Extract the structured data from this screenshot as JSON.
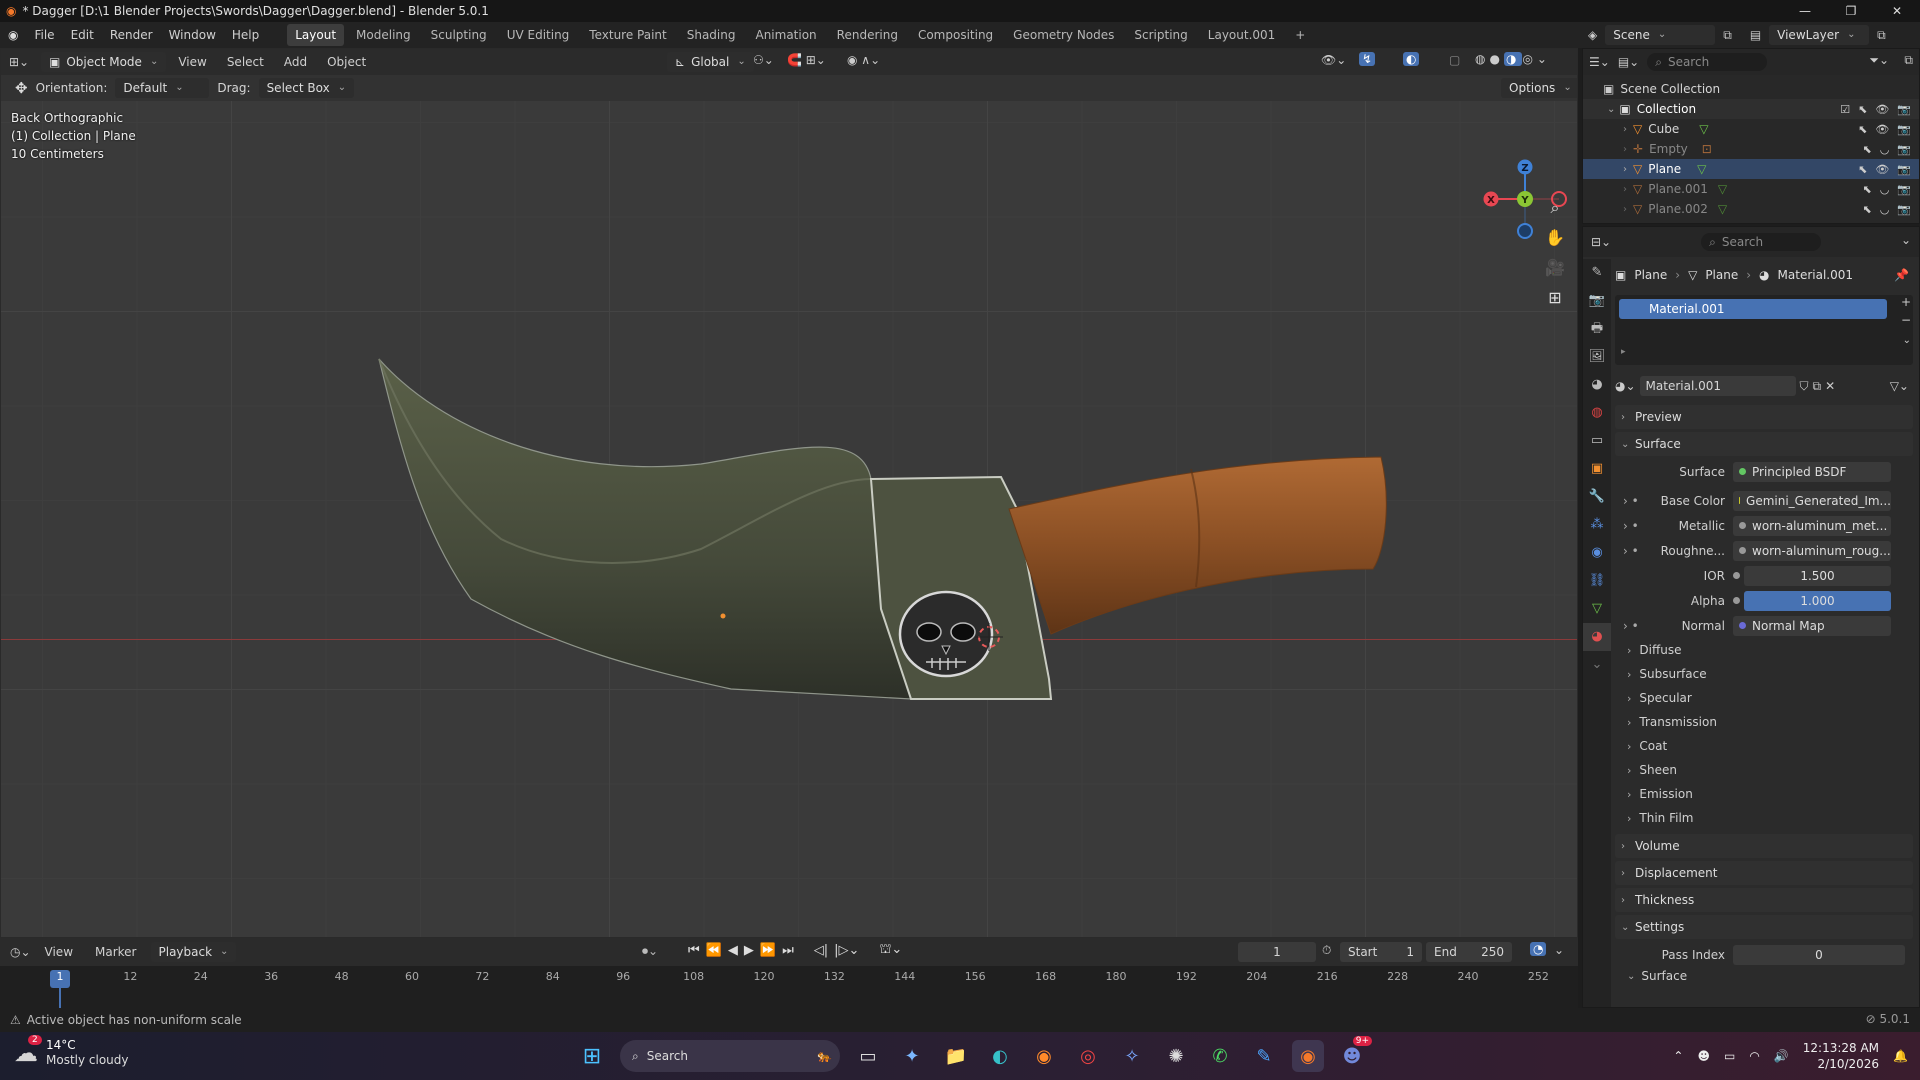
{
  "titlebar": {
    "title": "* Dagger [D:\\1 Blender Projects\\Swords\\Dagger\\Dagger.blend] - Blender 5.0.1"
  },
  "menu": [
    "File",
    "Edit",
    "Render",
    "Window",
    "Help"
  ],
  "workspaces": [
    "Layout",
    "Modeling",
    "Sculpting",
    "UV Editing",
    "Texture Paint",
    "Shading",
    "Animation",
    "Rendering",
    "Compositing",
    "Geometry Nodes",
    "Scripting",
    "Layout.001"
  ],
  "scene": {
    "label": "Scene",
    "viewlayer": "ViewLayer"
  },
  "viewport": {
    "mode": "Object Mode",
    "menus": [
      "View",
      "Select",
      "Add",
      "Object"
    ],
    "transform_orientation": "Global",
    "orientation_label": "Orientation:",
    "orientation_value": "Default",
    "drag_label": "Drag:",
    "drag_value": "Select Box",
    "options": "Options",
    "info": [
      "Back Orthographic",
      "(1) Collection | Plane",
      "10 Centimeters"
    ],
    "gizmo": {
      "z": "Z",
      "y": "Y",
      "x": "X"
    }
  },
  "timeline": {
    "menus": [
      "View",
      "Marker",
      "Playback"
    ],
    "current_frame": "1",
    "start_label": "Start",
    "start": "1",
    "end_label": "End",
    "end": "250",
    "ticks": [
      "1",
      "12",
      "24",
      "36",
      "48",
      "60",
      "72",
      "84",
      "96",
      "108",
      "120",
      "132",
      "144",
      "156",
      "168",
      "180",
      "192",
      "204",
      "216",
      "228",
      "240",
      "252"
    ]
  },
  "status": {
    "message": "Active object has non-uniform scale",
    "version": "5.0.1"
  },
  "outliner": {
    "search_placeholder": "Search",
    "root": "Scene Collection",
    "collection": "Collection",
    "items": [
      "Cube",
      "Empty",
      "Plane",
      "Plane.001",
      "Plane.002"
    ]
  },
  "properties": {
    "search_placeholder": "Search",
    "breadcrumb": [
      "Plane",
      "Plane",
      "Material.001"
    ],
    "slot": "Material.001",
    "material_name": "Material.001",
    "sections": {
      "preview": "Preview",
      "surface": "Surface",
      "volume": "Volume",
      "displacement": "Displacement",
      "thickness": "Thickness",
      "settings": "Settings",
      "surface2": "Surface"
    },
    "surface_label": "Surface",
    "surface_value": "Principled BSDF",
    "base_color_label": "Base Color",
    "base_color_value": "Gemini_Generated_Im...",
    "metallic_label": "Metallic",
    "metallic_value": "worn-aluminum_met...",
    "roughness_label": "Roughne...",
    "roughness_value": "worn-aluminum_roug...",
    "ior_label": "IOR",
    "ior_value": "1.500",
    "alpha_label": "Alpha",
    "alpha_value": "1.000",
    "normal_label": "Normal",
    "normal_value": "Normal Map",
    "subsections": [
      "Diffuse",
      "Subsurface",
      "Specular",
      "Transmission",
      "Coat",
      "Sheen",
      "Emission",
      "Thin Film"
    ],
    "pass_index_label": "Pass Index",
    "pass_index_value": "0"
  },
  "taskbar": {
    "weather_temp": "14°C",
    "weather_desc": "Mostly cloudy",
    "weather_badge": "2",
    "search": "Search",
    "time": "12:13:28 AM",
    "date": "2/10/2026",
    "discord_badge": "9+"
  },
  "colors": {
    "accent": "#4772b3",
    "x_axis": "#e84752",
    "y_axis": "#8bc634",
    "z_axis": "#3f81d6"
  }
}
